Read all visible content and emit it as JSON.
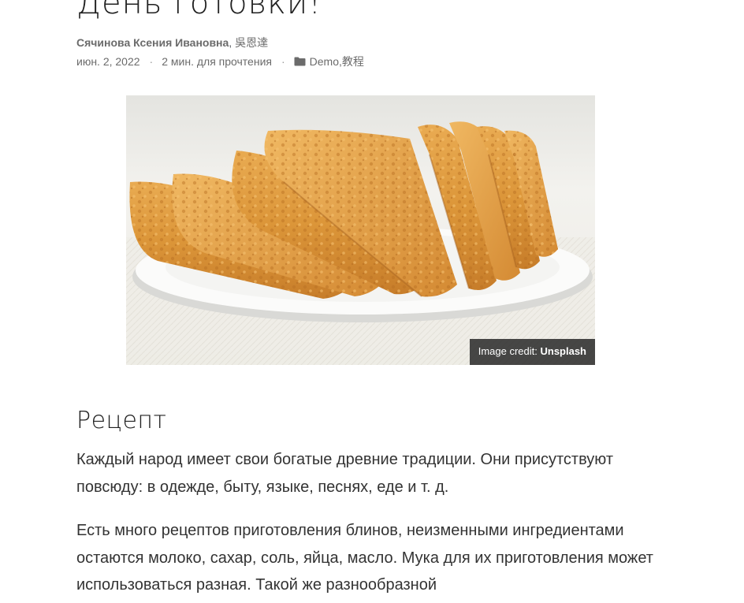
{
  "post": {
    "title": "День готовки!",
    "author_primary": "Сячинова Ксения Ивановна",
    "author_separator": ", ",
    "author_secondary": "吳恩達",
    "date": "июн. 2, 2022",
    "dot_1": "·",
    "reading_time": "2 мин. для прочтения",
    "dot_2": "·",
    "category_1": "Demo",
    "category_separator": ", ",
    "category_2": "教程",
    "category_icon": "folder-icon"
  },
  "featured_image": {
    "credit_prefix": "Image credit: ",
    "credit_source": "Unsplash"
  },
  "content": {
    "heading": "Рецепт",
    "paragraph_1": "Каждый народ имеет свои богатые древние традиции. Они присутствуют повсюду: в одежде, быту, языке, песнях, еде и т. д.",
    "paragraph_2": "Есть много рецептов приготовления блинов, неизменными ингредиентами остаются молоко, сахар, соль, яйца, масло. Мука для их приготовления может использоваться разная. Такой же разнообразной"
  },
  "colors": {
    "text": "#333333",
    "meta": "#6b6b6b",
    "credit_background": "#282828"
  }
}
